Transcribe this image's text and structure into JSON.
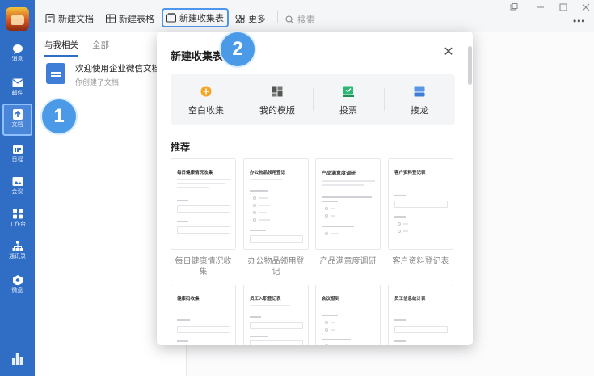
{
  "sidebar": {
    "items": [
      {
        "label": "消息",
        "icon": "chat-bubble-icon"
      },
      {
        "label": "邮件",
        "icon": "mail-icon"
      },
      {
        "label": "文档",
        "icon": "document-icon"
      },
      {
        "label": "日程",
        "icon": "calendar-icon"
      },
      {
        "label": "会议",
        "icon": "meeting-icon"
      },
      {
        "label": "工作台",
        "icon": "workbench-icon"
      },
      {
        "label": "通讯录",
        "icon": "contacts-icon"
      },
      {
        "label": "微盘",
        "icon": "cloud-drive-icon"
      }
    ]
  },
  "toolbar": {
    "new_doc": "新建文档",
    "new_sheet": "新建表格",
    "new_form": "新建收集表",
    "more": "更多",
    "search_placeholder": "搜索"
  },
  "panel": {
    "tab_mine": "与我相关",
    "tab_all": "全部",
    "doc_title": "欢迎使用企业微信文档",
    "doc_sub": "你创建了文档"
  },
  "badges": {
    "one": "1",
    "two": "2"
  },
  "modal": {
    "title": "新建收集表",
    "actions": [
      {
        "label": "空白收集",
        "icon": "plus-circle-icon",
        "color": "#f5a623"
      },
      {
        "label": "我的模版",
        "icon": "grid-template-icon",
        "color": "#555555"
      },
      {
        "label": "投票",
        "icon": "vote-check-icon",
        "color": "#2bb673"
      },
      {
        "label": "接龙",
        "icon": "chain-list-icon",
        "color": "#3e7ed8"
      }
    ],
    "section_title": "推荐",
    "templates_row1": [
      {
        "card_title": "每日健康情况收集",
        "label_line1": "每日健康情况收",
        "label_line2": "集"
      },
      {
        "card_title": "办公物品领用登记",
        "label_line1": "办公物品领用登",
        "label_line2": "记"
      },
      {
        "card_title": "产品满意度调研",
        "label_line1": "产品满意度调研",
        "label_line2": ""
      },
      {
        "card_title": "客户资料登记表",
        "label_line1": "客户资料登记表",
        "label_line2": ""
      }
    ],
    "templates_row2": [
      {
        "card_title": "健康码收集"
      },
      {
        "card_title": "员工入职登记表"
      },
      {
        "card_title": "会议报到"
      },
      {
        "card_title": "员工信息统计表"
      }
    ]
  }
}
